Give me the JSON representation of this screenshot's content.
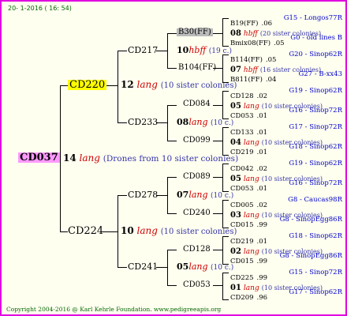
{
  "header": "20- 1-2016 ( 16: 54)",
  "footer": "Copyright 2004-2016 @ Karl Kehrle Foundation.   www.pedigreeapis.org",
  "root": {
    "name": "CD037",
    "num": "14",
    "lang": "lang",
    "desc": "(Drones from 10 sister colonies)"
  },
  "sire": {
    "name": "CD220",
    "num": "12",
    "lang": "lang",
    "desc": "(10 sister colonies)"
  },
  "dam": {
    "name": "CD224",
    "num": "10",
    "lang": "lang",
    "desc": "(10 sister colonies)"
  },
  "gen3": [
    {
      "name": "CD217",
      "num": "10",
      "mark": "hbff",
      "desc": "(19 c.)"
    },
    {
      "name": "CD233",
      "num": "08",
      "mark": "lang",
      "desc": "(10 c.)"
    },
    {
      "name": "CD278",
      "num": "07",
      "mark": "lang",
      "desc": "(10 c.)"
    },
    {
      "name": "CD241",
      "num": "05",
      "mark": "lang",
      "desc": "(10 c.)"
    }
  ],
  "gen4": [
    "B30(FF)",
    "B104(FF)",
    "CD084",
    "CD099",
    "CD089",
    "CD240",
    "CD128",
    "CD053"
  ],
  "gen5": [
    {
      "left": "B19(FF)",
      "yr": ".06",
      "src": "G15 - Longos77R"
    },
    {
      "num": "08",
      "mark": "hbff",
      "desc": "(20 sister colonies)"
    },
    {
      "left": "Bmix08(FF)",
      "yr": ".05",
      "src": "G0 - old lines B"
    },
    {
      "left": "B114(FF)",
      "yr": ".05",
      "src": "G20 - Sinop62R"
    },
    {
      "num": "07",
      "mark": "hbff",
      "desc": "(16 sister colonies)"
    },
    {
      "left": "B811(FF)",
      "yr": ".04",
      "src": "G27 - B-xx43"
    },
    {
      "left": "CD128",
      "yr": ".02",
      "src": "G19 - Sinop62R"
    },
    {
      "num": "05",
      "mark": "lang",
      "desc": "(10 sister colonies)"
    },
    {
      "left": "CD053",
      "yr": ".01",
      "src": "G16 - Sinop72R"
    },
    {
      "left": "CD133",
      "yr": ".01",
      "src": "G17 - Sinop72R"
    },
    {
      "num": "04",
      "mark": "lang",
      "desc": "(10 sister colonies)"
    },
    {
      "left": "CD219",
      "yr": ".01",
      "src": "G18 - Sinop62R"
    },
    {
      "left": "CD042",
      "yr": ".02",
      "src": "G19 - Sinop62R"
    },
    {
      "num": "05",
      "mark": "lang",
      "desc": "(10 sister colonies)"
    },
    {
      "left": "CD053",
      "yr": ".01",
      "src": "G16 - Sinop72R"
    },
    {
      "left": "CD005",
      "yr": ".02",
      "src": "G8 - Caucas98R"
    },
    {
      "num": "03",
      "mark": "lang",
      "desc": "(10 sister colonies)"
    },
    {
      "left": "CD015",
      "yr": ".99",
      "src": "G8 - SinopEgg86R"
    },
    {
      "left": "CD219",
      "yr": ".01",
      "src": "G18 - Sinop62R"
    },
    {
      "num": "02",
      "mark": "lang",
      "desc": "(10 sister colonies)"
    },
    {
      "left": "CD015",
      "yr": ".99",
      "src": "G8 - SinopEgg86R"
    },
    {
      "left": "CD225",
      "yr": ".99",
      "src": "G15 - Sinop72R"
    },
    {
      "num": "01",
      "mark": "lang",
      "desc": "(10 sister colonies)"
    },
    {
      "left": "CD209",
      "yr": ".96",
      "src": "G17 - Sinop62R"
    }
  ],
  "colors": {
    "border": "#e000e0",
    "sire_hl": "#ffff00",
    "root_hl": "#ff99ff",
    "mark_red": "#cc0000",
    "src_blue": "#0000cc",
    "green": "#006600"
  }
}
